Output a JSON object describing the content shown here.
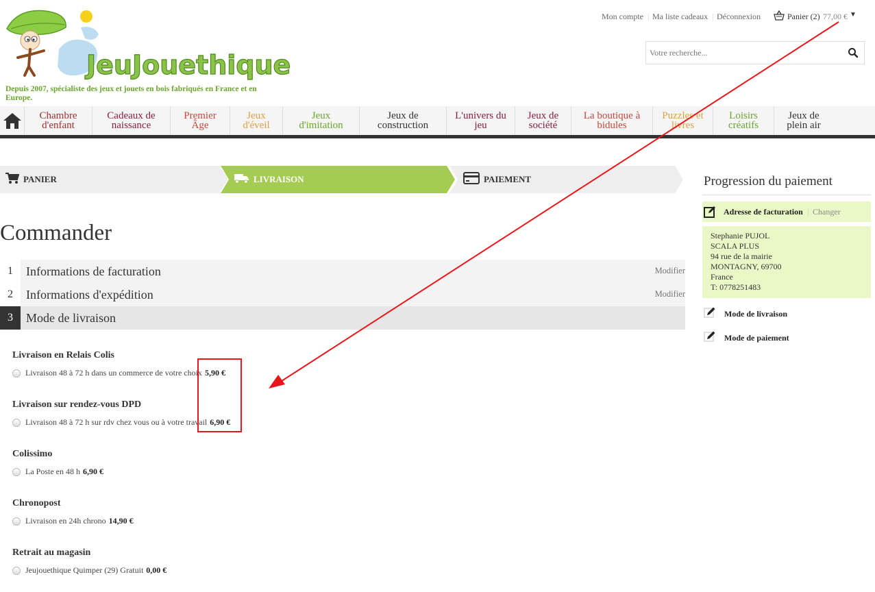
{
  "brand": {
    "name": "JeuJouethique",
    "tagline": "Depuis 2007, spécialiste des jeux et jouets en bois fabriqués en France et en Europe."
  },
  "account_links": {
    "my_account": "Mon compte",
    "wishlist": "Ma liste cadeaux",
    "logout": "Déconnexion",
    "cart_label": "Panier (2)",
    "cart_total": "77,00 €"
  },
  "search": {
    "placeholder": "Votre recherche..."
  },
  "nav": [
    {
      "line1": "Chambre",
      "line2": "d'enfant",
      "color": "#a52d2d"
    },
    {
      "line1": "Cadeaux de",
      "line2": "naissance",
      "color": "#8a1c3c"
    },
    {
      "line1": "Premier",
      "line2": "Âge",
      "color": "#c8463a"
    },
    {
      "line1": "Jeux",
      "line2": "d'éveil",
      "color": "#e0a040"
    },
    {
      "line1": "Jeux",
      "line2": "d'imitation",
      "color": "#6aa52c"
    },
    {
      "line1": "Jeux de",
      "line2": "construction",
      "color": "#333333"
    },
    {
      "line1": "L'univers du",
      "line2": "jeu",
      "color": "#8a1c3c"
    },
    {
      "line1": "Jeux de",
      "line2": "société",
      "color": "#8a1c3c"
    },
    {
      "line1": "La boutique à",
      "line2": "bidules",
      "color": "#c8463a"
    },
    {
      "line1": "Puzzles et",
      "line2": "livres",
      "color": "#e0a040"
    },
    {
      "line1": "Loisirs",
      "line2": "créatifs",
      "color": "#6aa52c"
    },
    {
      "line1": "Jeux de",
      "line2": "plein air",
      "color": "#333333"
    }
  ],
  "steps": {
    "cart": "PANIER",
    "delivery": "LIVRAISON",
    "payment": "PAIEMENT"
  },
  "page_title": "Commander",
  "accordion": [
    {
      "num": "1",
      "label": "Informations de facturation",
      "action": "Modifier"
    },
    {
      "num": "2",
      "label": "Informations d'expédition",
      "action": "Modifier"
    },
    {
      "num": "3",
      "label": "Mode de livraison",
      "action": ""
    }
  ],
  "shipping_methods": [
    {
      "title": "Livraison en Relais Colis",
      "option": "Livraison 48 à 72 h dans un commerce de votre choix",
      "price": "5,90 €"
    },
    {
      "title": "Livraison sur rendez-vous DPD",
      "option": "Livraison 48 à 72 h sur rdv chez vous ou à votre travail",
      "price": "6,90 €"
    },
    {
      "title": "Colissimo",
      "option": "La Poste en 48 h",
      "price": "6,90 €"
    },
    {
      "title": "Chronopost",
      "option": "Livraison en 24h chrono",
      "price": "14,90 €"
    },
    {
      "title": "Retrait au magasin",
      "option": "Jeujouethique Quimper (29) Gratuit",
      "price": "0,00 €"
    }
  ],
  "sidebar": {
    "title": "Progression du paiement",
    "billing_label": "Adresse de facturation",
    "change": "Changer",
    "address": [
      "Stephanie PUJOL",
      "SCALA PLUS",
      "94 rue de la mairie",
      "MONTAGNY, 69700",
      "France",
      "T: 0778251483"
    ],
    "delivery_mode": "Mode de livraison",
    "payment_mode": "Mode de paiement"
  },
  "colors": {
    "accent_green": "#a5cc52",
    "light_green": "#e9f8c6",
    "annotation_red": "#e8161a"
  }
}
